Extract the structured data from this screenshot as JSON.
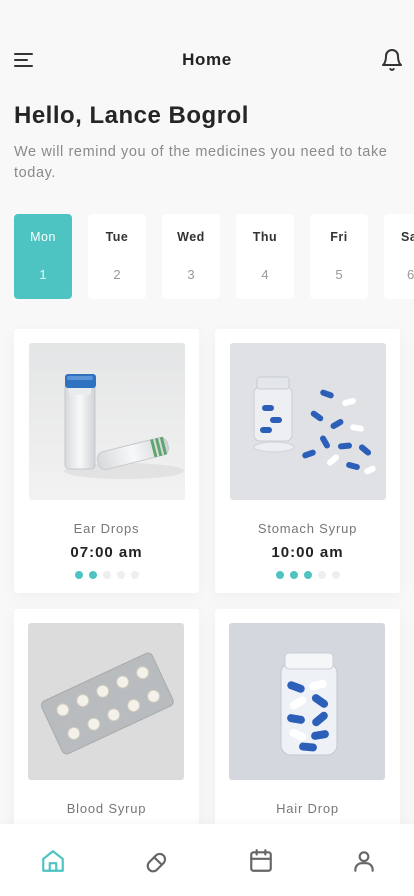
{
  "header": {
    "title": "Home",
    "menu_icon": "hamburger-menu-icon",
    "bell_icon": "bell-icon"
  },
  "greeting": "Hello, Lance Bogrol",
  "subtitle": "We will remind you of the medicines you need to take today.",
  "days": [
    {
      "name": "Mon",
      "num": "1",
      "active": true
    },
    {
      "name": "Tue",
      "num": "2"
    },
    {
      "name": "Wed",
      "num": "3"
    },
    {
      "name": "Thu",
      "num": "4"
    },
    {
      "name": "Fri",
      "num": "5"
    },
    {
      "name": "Sa",
      "num": "6"
    }
  ],
  "medicines": [
    {
      "name": "Ear Drops",
      "time": "07:00 am",
      "dose_progress": "2/5"
    },
    {
      "name": "Stomach Syrup",
      "time": "10:00 am",
      "dose_progress": "3/5"
    },
    {
      "name": "Blood Syrup",
      "time": ""
    },
    {
      "name": "Hair Drop",
      "time": ""
    }
  ],
  "tabbar": {
    "items": [
      "home-icon",
      "pill-icon",
      "calendar-icon",
      "profile-icon"
    ],
    "active": "home-icon"
  },
  "colors": {
    "accent": "#4ec4c2",
    "background": "#f8f8f8",
    "card": "#ffffff",
    "text": "#2d2d2d",
    "muted": "#8a8a8a"
  }
}
